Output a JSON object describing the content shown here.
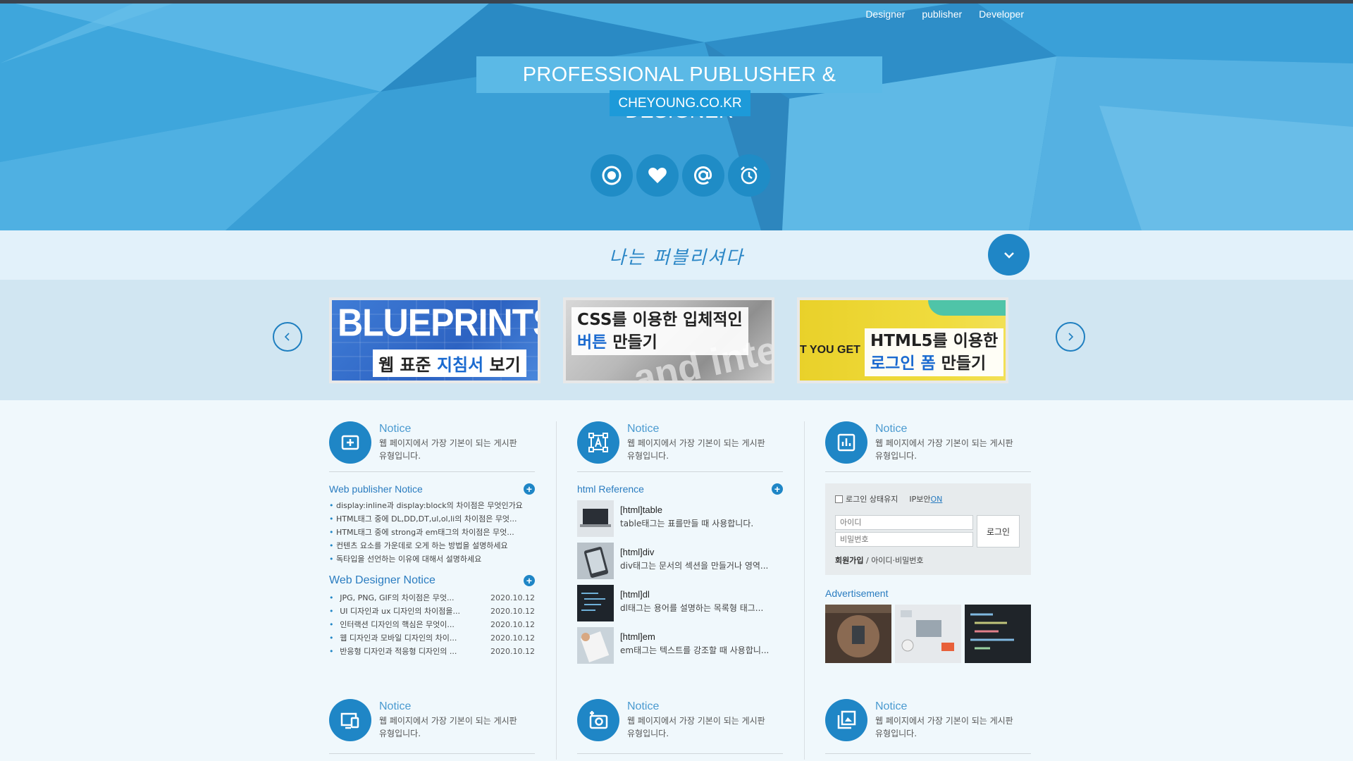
{
  "nav": {
    "items": [
      "Designer",
      "publisher",
      "Developer"
    ]
  },
  "hero": {
    "title": "PROFESSIONAL PUBLUSHER & DESIGNER",
    "subtitle": "CHEYOUNG.CO.KR",
    "icons": [
      "record-icon",
      "heart-icon",
      "at-icon",
      "alarm-clock-icon"
    ],
    "colors": {
      "accent": "#1f86c6",
      "title_bg": "#5bb9e6",
      "subtitle_bg": "#1d9ad9"
    }
  },
  "tagline": "나는 퍼블리셔다",
  "slides": [
    {
      "big": "BLUEPRINTS",
      "label_pre": "웹 표준 ",
      "label_hl": "지침서",
      "label_post": " 보기"
    },
    {
      "line1": "CSS를 이용한 입체적인",
      "line2_hl": "버튼",
      "line2_post": " 만들기",
      "deco": "and inte"
    },
    {
      "side": "T YOU GET",
      "line1": "HTML5를 이용한",
      "line2_hl": "로그인 폼",
      "line2_post": " 만들기"
    }
  ],
  "columns": [
    {
      "notice": {
        "title": "Notice",
        "desc_line1": "웹 페이지에서 가장 기본이 되는 게시판",
        "desc_line2": "유형입니다."
      },
      "section1": {
        "title": "Web publisher Notice",
        "items": [
          "display:inline과 display:block의 차이점은 무엇인가요",
          "HTML태그 중에 DL,DD,DT,ul,ol,li의 차이점은 무엇...",
          "HTML태그 중에 strong과 em태그의 차이점은 무엇...",
          "컨텐츠 요소를 가운데로 오게 하는 방법을 설명하세요",
          "독타입을 선언하는 이유에 대해서 설명하세요"
        ]
      },
      "section2": {
        "title": "Web Designer Notice",
        "items": [
          {
            "t": "JPG, PNG, GIF의 차이점은 무엇...",
            "d": "2020.10.12"
          },
          {
            "t": "UI 디자인과 ux 디자인의 차이점을...",
            "d": "2020.10.12"
          },
          {
            "t": "인터랙션 디자인의 핵심은 무엇이...",
            "d": "2020.10.12"
          },
          {
            "t": "웹 디자인과 모바일 디자인의 차이...",
            "d": "2020.10.12"
          },
          {
            "t": "반응형 디자인과 적응형 디자인의 ...",
            "d": "2020.10.12"
          }
        ]
      }
    },
    {
      "notice": {
        "title": "Notice",
        "desc_line1": "웹 페이지에서 가장 기본이 되는 게시판",
        "desc_line2": "유형입니다."
      },
      "section1": {
        "title": "html Reference",
        "items": [
          {
            "t": "[html]table",
            "d": "table태그는 표를만들 때 사용합니다."
          },
          {
            "t": "[html]div",
            "d": "div태그는 문서의 섹션을 만들거나 영역..."
          },
          {
            "t": "[html]dl",
            "d": "dl태그는 용어를 설명하는 목록형 태그..."
          },
          {
            "t": "[html]em",
            "d": "em태그는 텍스트를 강조할 때 사용합니..."
          }
        ]
      }
    },
    {
      "notice": {
        "title": "Notice",
        "desc_line1": "웹 페이지에서 가장 기본이 되는 게시판",
        "desc_line2": "유형입니다."
      },
      "login": {
        "remember": "로그인 상태유지",
        "ip_label": "IP보안",
        "ip_state": "ON",
        "id_placeholder": "아이디",
        "pw_placeholder": "비밀번호",
        "button": "로그인",
        "join": "회원가입",
        "sep": " / ",
        "find": "아이디·비밀번호"
      },
      "ad_title": "Advertisement"
    }
  ],
  "bottom_notices": [
    {
      "title": "Notice",
      "desc_line1": "웹 페이지에서 가장 기본이 되는 게시판",
      "desc_line2": "유형입니다."
    },
    {
      "title": "Notice",
      "desc_line1": "웹 페이지에서 가장 기본이 되는 게시판",
      "desc_line2": "유형입니다."
    },
    {
      "title": "Notice",
      "desc_line1": "웹 페이지에서 가장 기본이 되는 게시판",
      "desc_line2": "유형입니다."
    }
  ]
}
